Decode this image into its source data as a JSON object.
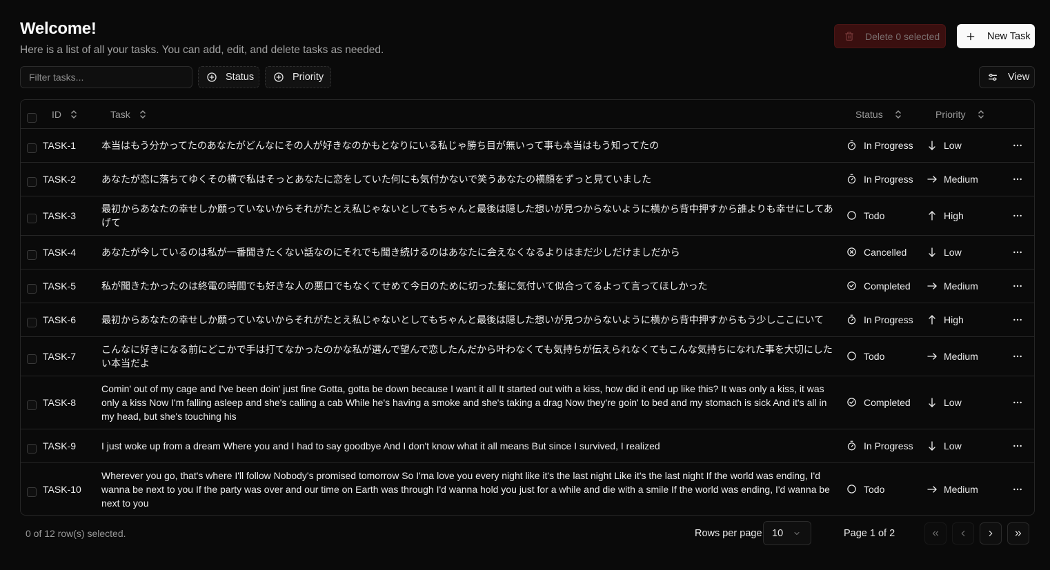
{
  "header": {
    "title": "Welcome!",
    "subtitle": "Here is a list of all your tasks. You can add, edit, and delete tasks as needed."
  },
  "actions": {
    "delete_label": "Delete 0 selected",
    "new_task_label": "New Task",
    "view_label": "View"
  },
  "toolbar": {
    "filter_placeholder": "Filter tasks...",
    "status_label": "Status",
    "priority_label": "Priority"
  },
  "table": {
    "columns": {
      "id": "ID",
      "task": "Task",
      "status": "Status",
      "priority": "Priority"
    },
    "rows": [
      {
        "id": "TASK-1",
        "task": "本当はもう分かってたのあなたがどんなにその人が好きなのかもとなりにいる私じゃ勝ち目が無いって事も本当はもう知ってたの",
        "status": "In Progress",
        "status_icon": "timer-icon",
        "priority": "Low",
        "priority_icon": "arrow-down-icon"
      },
      {
        "id": "TASK-2",
        "task": "あなたが恋に落ちてゆくその横で私はそっとあなたに恋をしていた何にも気付かないで笑うあなたの横顔をずっと見ていました",
        "status": "In Progress",
        "status_icon": "timer-icon",
        "priority": "Medium",
        "priority_icon": "arrow-right-icon"
      },
      {
        "id": "TASK-3",
        "task": "最初からあなたの幸せしか願っていないからそれがたとえ私じゃないとしてもちゃんと最後は隠した想いが見つからないように横から背中押すから誰よりも幸せにしてあげて",
        "status": "Todo",
        "status_icon": "circle-icon",
        "priority": "High",
        "priority_icon": "arrow-up-icon"
      },
      {
        "id": "TASK-4",
        "task": "あなたが今しているのは私が一番聞きたくない話なのにそれでも聞き続けるのはあなたに会えなくなるよりはまだ少しだけましだから",
        "status": "Cancelled",
        "status_icon": "circle-x-icon",
        "priority": "Low",
        "priority_icon": "arrow-down-icon"
      },
      {
        "id": "TASK-5",
        "task": "私が聞きたかったのは終電の時間でも好きな人の悪口でもなくてせめて今日のために切った髪に気付いて似合ってるよって言ってほしかった",
        "status": "Completed",
        "status_icon": "check-circle-icon",
        "priority": "Medium",
        "priority_icon": "arrow-right-icon"
      },
      {
        "id": "TASK-6",
        "task": "最初からあなたの幸せしか願っていないからそれがたとえ私じゃないとしてもちゃんと最後は隠した想いが見つからないように横から背中押すからもう少しここにいて",
        "status": "In Progress",
        "status_icon": "timer-icon",
        "priority": "High",
        "priority_icon": "arrow-up-icon"
      },
      {
        "id": "TASK-7",
        "task": "こんなに好きになる前にどこかで手は打てなかったのかな私が選んで望んで恋したんだから叶わなくても気持ちが伝えられなくてもこんな気持ちになれた事を大切にしたい本当だよ",
        "status": "Todo",
        "status_icon": "circle-icon",
        "priority": "Medium",
        "priority_icon": "arrow-right-icon"
      },
      {
        "id": "TASK-8",
        "task": "Comin' out of my cage and I've been doin' just fine Gotta, gotta be down because I want it all It started out with a kiss, how did it end up like this? It was only a kiss, it was only a kiss Now I'm falling asleep and she's calling a cab While he's having a smoke and she's taking a drag Now they're goin' to bed and my stomach is sick And it's all in my head, but she's touching his",
        "status": "Completed",
        "status_icon": "check-circle-icon",
        "priority": "Low",
        "priority_icon": "arrow-down-icon"
      },
      {
        "id": "TASK-9",
        "task": "I just woke up from a dream Where you and I had to say goodbye And I don't know what it all means But since I survived, I realized",
        "status": "In Progress",
        "status_icon": "timer-icon",
        "priority": "Low",
        "priority_icon": "arrow-down-icon"
      },
      {
        "id": "TASK-10",
        "task": "Wherever you go, that's where I'll follow Nobody's promised tomorrow So I'ma love you every night like it's the last night Like it's the last night If the world was ending, I'd wanna be next to you If the party was over and our time on Earth was through I'd wanna hold you just for a while and die with a smile If the world was ending, I'd wanna be next to you",
        "status": "Todo",
        "status_icon": "circle-icon",
        "priority": "Medium",
        "priority_icon": "arrow-right-icon"
      }
    ]
  },
  "footer": {
    "selection_text": "0 of 12 row(s) selected.",
    "rows_per_page_label": "Rows per page",
    "rows_per_page_value": "10",
    "page_info": "Page 1 of 2"
  }
}
